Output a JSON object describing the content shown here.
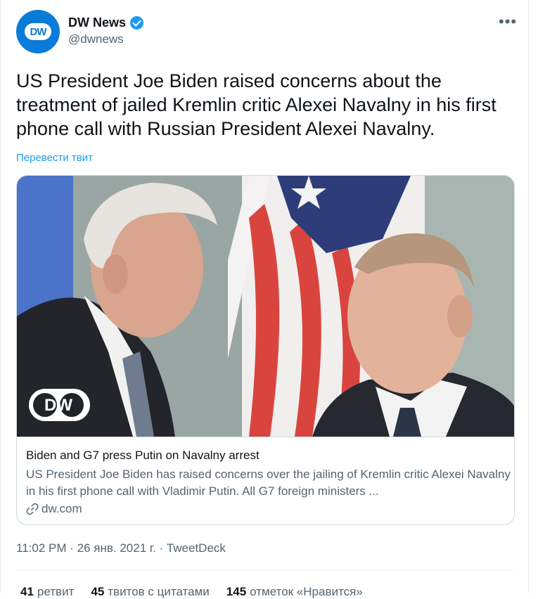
{
  "author": {
    "name": "DW News",
    "handle": "@dwnews",
    "avatar_text": "DW",
    "verified": true
  },
  "menu_icon": "more-horizontal-icon",
  "tweet_text": "US President Joe Biden raised concerns about the treatment of jailed Kremlin critic Alexei Navalny in his first phone call with Russian President Alexei Navalny.",
  "translate_label": "Перевести твит",
  "card": {
    "image_logo_text": "DW",
    "title": "Biden and G7 press Putin on Navalny arrest",
    "description": "US President Joe Biden has raised concerns over the jailing of Kremlin critic Alexei Navalny in his first phone call with Vladimir Putin. All G7 foreign ministers ...",
    "link_icon": "link-icon",
    "domain": "dw.com"
  },
  "meta": {
    "time": "11:02 PM",
    "separator": " · ",
    "date": "26 янв. 2021 г.",
    "source": "TweetDeck"
  },
  "stats": [
    {
      "count": "41",
      "label": "ретвит"
    },
    {
      "count": "45",
      "label": "твитов с цитатами"
    },
    {
      "count": "145",
      "label": "отметок «Нравится»"
    }
  ],
  "colors": {
    "accent": "#1d9bf0",
    "brand": "#0a7bd8",
    "muted": "#536471",
    "text": "#0f1419"
  }
}
